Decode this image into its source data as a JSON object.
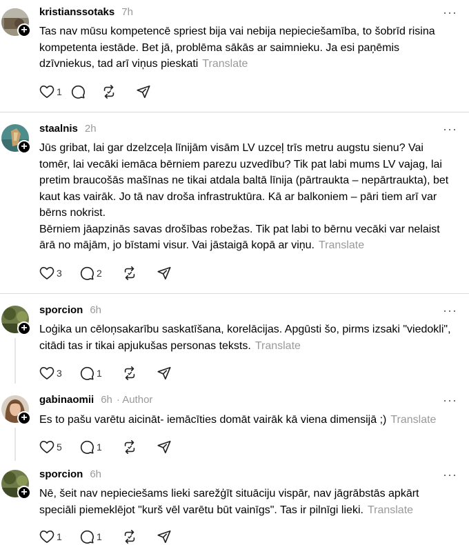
{
  "posts": [
    {
      "username": "kristianssotaks",
      "time": "7h",
      "text": "Tas nav mūsu kompetencē spriest bija vai nebija nepieciešamība, to šobrīd risina kompetenta iestāde. Bet jā, problēma sākās ar saimnieku. Ja esi paņēmis dzīvniekus, tad arī viņus pieskati",
      "translate": "Translate",
      "likes": "1",
      "replies": "",
      "more": "···"
    },
    {
      "username": "staalnis",
      "time": "2h",
      "text_lines": [
        "Jūs gribat, lai gar dzelzceļa līnijām visām LV uzceļ trīs metru augstu sienu? Vai tomēr, lai vecāki iemāca bērniem parezu uzvedību? Tik pat labi mums LV vajag, lai pretim braucošās mašīnas ne tikai atdala baltā līnija (pārtraukta – nepārtraukta), bet kaut kas vairāk. Jo tā nav droša infrastruktūra. Kā ar balkoniem – pāri tiem arī var bērns nokrist.",
        "Bērniem jāapzinās savas drošības robežas. Tik pat labi to bērnu vecāki var nelaist ārā no mājām, jo bīstami visur. Vai jāstaigā kopā ar viņu."
      ],
      "translate": "Translate",
      "likes": "3",
      "replies": "2",
      "more": "···"
    },
    {
      "username": "sporcion",
      "time": "6h",
      "text": "Loģika un cēloņsakarību saskatīšana, korelācijas. Apgūsti šo, pirms izsaki \"viedokli\", citādi tas ir tikai apjukušas personas teksts.",
      "translate": "Translate",
      "likes": "3",
      "replies": "1",
      "more": "···"
    },
    {
      "username": "gabinaomii",
      "time": "6h",
      "author_tag": "· Author",
      "text": "Es to pašu varētu aicināt- iemācīties domāt vairāk kā viena dimensijā ;)",
      "translate": "Translate",
      "likes": "5",
      "replies": "1",
      "more": "···"
    },
    {
      "username": "sporcion",
      "time": "6h",
      "text": "Nē, šeit nav nepieciešams lieki sarežģīt situāciju vispār, nav jāgrābstās apkārt speciāli piemeklējot \"kurš vēl varētu būt vainīgs\". Tas ir pilnīgi lieki.",
      "translate": "Translate",
      "likes": "1",
      "replies": "1",
      "more": "···"
    }
  ],
  "icons": [
    "heart-icon",
    "comment-icon",
    "repost-icon",
    "share-icon",
    "follow-plus-icon",
    "more-icon"
  ],
  "colors": {
    "text": "#000000",
    "muted": "#999999",
    "divider": "#dcdcdc",
    "thread_line": "#e6e6e6"
  }
}
